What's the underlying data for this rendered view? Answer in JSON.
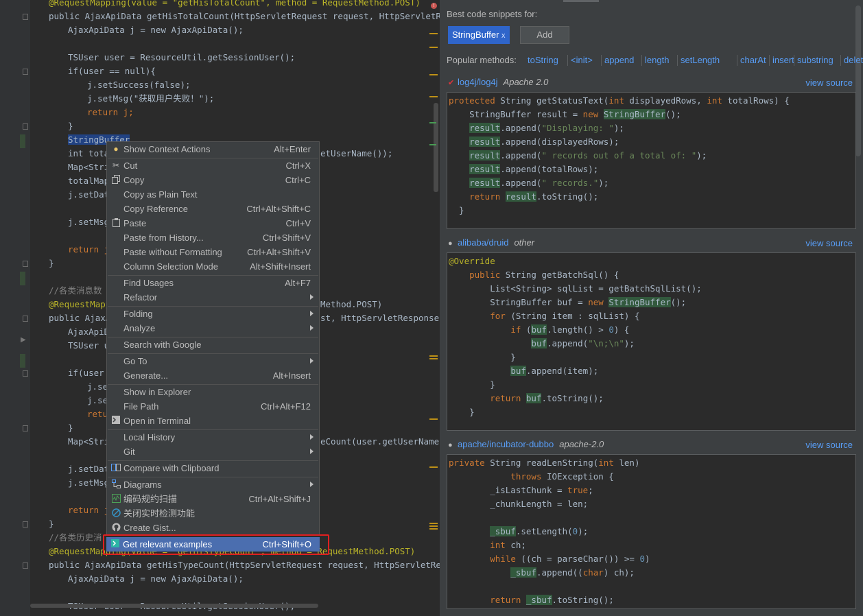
{
  "editor": {
    "code": {
      "l0": "@RequestMapping(value = \"getHisTotalCount\", method = RequestMethod.POST)",
      "l1": "public AjaxApiData getHisTotalCount(HttpServletRequest request, HttpServletResponse",
      "l2": "AjaxApiData j = new AjaxApiData();",
      "l3": "TSUser user = ResourceUtil.getSessionUser();",
      "l4": "if(user == null){",
      "l5": "j.setSuccess(false);",
      "l6": "j.setMsg(\"获取用户失败！\");",
      "l7": "return j;",
      "l8": "}",
      "l9": "StringBuffer",
      "l10_head": "int tota",
      "l10_tail": "etUserName());",
      "l11": "Map<Stri",
      "l12": "totalMap",
      "l13": "j.setDat",
      "l14": "j.setMsg",
      "l15": "return j",
      "l16": "}",
      "l17": "//各类消息数",
      "l18_head": "@RequestMappi",
      "l18_tail": "Method.POST)",
      "l19_head": "public AjaxA",
      "l19_tail": "st, HttpServletResponse r",
      "l20": "AjaxApiD",
      "l21": "TSUser u",
      "l22": "if(user",
      "l23": "j.se",
      "l24": "j.se",
      "l25": "retu",
      "l26": "}",
      "l27_head": "Map<Stri",
      "l27_tail": "eCount(user.getUserName(),",
      "l28": "j.setDat",
      "l29": "j.setMsg",
      "l30": "return j",
      "l31": "}",
      "l32": "//各类历史消",
      "l33": "@RequestMapping(value = \"getHisTypeCount\", method = RequestMethod.POST)",
      "l34": "public AjaxApiData getHisTypeCount(HttpServletRequest request, HttpServletResponse",
      "l35": "AjaxApiData j = new AjaxApiData();",
      "l36": "TSUser user = ResourceUtil.getSessionUser();"
    },
    "error_mark": "!"
  },
  "context_menu": {
    "items": [
      {
        "label": "Show Context Actions",
        "shortcut": "Alt+Enter",
        "icon": "bulb-icon"
      },
      {
        "label": "Cut",
        "shortcut": "Ctrl+X",
        "icon": "scissors-icon"
      },
      {
        "label": "Copy",
        "shortcut": "Ctrl+C",
        "icon": "copy-icon"
      },
      {
        "label": "Copy as Plain Text",
        "shortcut": ""
      },
      {
        "label": "Copy Reference",
        "shortcut": "Ctrl+Alt+Shift+C"
      },
      {
        "label": "Paste",
        "shortcut": "Ctrl+V",
        "icon": "paste-icon"
      },
      {
        "label": "Paste from History...",
        "shortcut": "Ctrl+Shift+V"
      },
      {
        "label": "Paste without Formatting",
        "shortcut": "Ctrl+Alt+Shift+V"
      },
      {
        "label": "Column Selection Mode",
        "shortcut": "Alt+Shift+Insert"
      },
      {
        "label": "Find Usages",
        "shortcut": "Alt+F7"
      },
      {
        "label": "Refactor",
        "shortcut": ""
      },
      {
        "label": "Folding",
        "shortcut": ""
      },
      {
        "label": "Analyze",
        "shortcut": ""
      },
      {
        "label": "Search with Google",
        "shortcut": ""
      },
      {
        "label": "Go To",
        "shortcut": ""
      },
      {
        "label": "Generate...",
        "shortcut": "Alt+Insert"
      },
      {
        "label": "Show in Explorer",
        "shortcut": ""
      },
      {
        "label": "File Path",
        "shortcut": "Ctrl+Alt+F12"
      },
      {
        "label": "Open in Terminal",
        "shortcut": "",
        "icon": "terminal-icon"
      },
      {
        "label": "Local History",
        "shortcut": ""
      },
      {
        "label": "Git",
        "shortcut": ""
      },
      {
        "label": "Compare with Clipboard",
        "shortcut": "",
        "icon": "compare-icon"
      },
      {
        "label": "Diagrams",
        "shortcut": "",
        "icon": "diagram-icon"
      },
      {
        "label": "编码规约扫描",
        "shortcut": "Ctrl+Alt+Shift+J",
        "icon": "scan-icon"
      },
      {
        "label": "关闭实时检测功能",
        "shortcut": "",
        "icon": "disable-icon"
      },
      {
        "label": "Create Gist...",
        "shortcut": "",
        "icon": "github-icon"
      },
      {
        "label": "Get relevant examples",
        "shortcut": "Ctrl+Shift+O",
        "icon": "codota-icon"
      }
    ]
  },
  "panel": {
    "heading": "Best code snippets for:",
    "chip_label": "StringBuffer",
    "chip_close": "x",
    "add_label": "Add",
    "popular_label": "Popular methods:",
    "methods": [
      "toString",
      "<init>",
      "append",
      "length",
      "setLength",
      "charAt",
      "insert",
      "substring",
      "delet"
    ],
    "view_source": "view source",
    "snippets": [
      {
        "repo": "log4j/log4j",
        "license": "Apache 2.0",
        "lines": [
          "protected String getStatusText(int displayedRows, int totalRows) {",
          "    StringBuffer result = new StringBuffer();",
          "    result.append(\"Displaying: \");",
          "    result.append(displayedRows);",
          "    result.append(\" records out of a total of: \");",
          "    result.append(totalRows);",
          "    result.append(\" records.\");",
          "    return result.toString();",
          "  }"
        ]
      },
      {
        "repo": "alibaba/druid",
        "license": "other",
        "lines": [
          "@Override",
          "    public String getBatchSql() {",
          "        List<String> sqlList = getBatchSqlList();",
          "        StringBuffer buf = new StringBuffer();",
          "        for (String item : sqlList) {",
          "            if (buf.length() > 0) {",
          "                buf.append(\"\\n;\\n\");",
          "            }",
          "            buf.append(item);",
          "        }",
          "        return buf.toString();",
          "    }"
        ]
      },
      {
        "repo": "apache/incubator-dubbo",
        "license": "apache-2.0",
        "lines": [
          "private String readLenString(int len)",
          "            throws IOException {",
          "        _isLastChunk = true;",
          "        _chunkLength = len;",
          "",
          "        _sbuf.setLength(0);",
          "        int ch;",
          "        while ((ch = parseChar()) >= 0)",
          "            _sbuf.append((char) ch);",
          "",
          "        return _sbuf.toString();"
        ]
      }
    ]
  },
  "colors": {
    "editor_bg": "#2b2b2b",
    "menu_bg": "#3c3f41",
    "menu_selected": "#4b6eaf",
    "highlight_box": "#e02020",
    "link": "#589df6",
    "chip_bg": "#2f65ca"
  }
}
